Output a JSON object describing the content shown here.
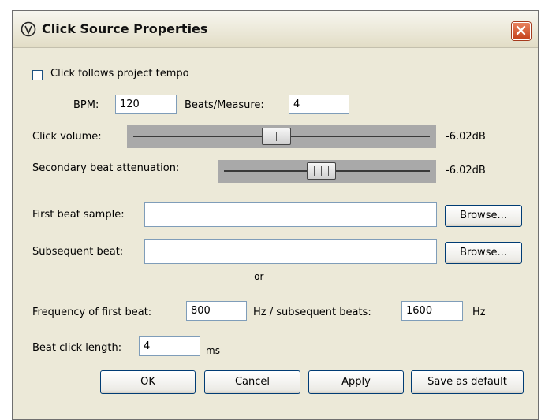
{
  "window": {
    "title": "Click Source Properties",
    "app_icon": "reaper-logo-icon",
    "close_icon": "close-icon"
  },
  "tempo": {
    "follow_label": "Click follows project tempo",
    "follow_checked": false,
    "bpm_label": "BPM:",
    "bpm_value": "120",
    "beats_label": "Beats/Measure:",
    "beats_value": "4"
  },
  "click_volume": {
    "label": "Click volume:",
    "value": "-6.02dB",
    "level": 0.5
  },
  "secondary_attenuation": {
    "label": "Secondary beat attenuation:",
    "value": "-6.02dB",
    "level": 0.5
  },
  "samples": {
    "first_label": "First beat sample:",
    "first_value": "",
    "first_browse": "Browse...",
    "subsequent_label": "Subsequent beat:",
    "subsequent_value": "",
    "subsequent_browse": "Browse...",
    "or_text": "- or -"
  },
  "frequency": {
    "first_label": "Frequency of first beat:",
    "first_value": "800",
    "sub_label": "Hz / subsequent beats:",
    "sub_value": "1600",
    "hz_unit": "Hz"
  },
  "length": {
    "label": "Beat click length:",
    "value": "4",
    "unit": "ms"
  },
  "buttons": {
    "ok": "OK",
    "cancel": "Cancel",
    "apply": "Apply",
    "save_default": "Save as default"
  }
}
